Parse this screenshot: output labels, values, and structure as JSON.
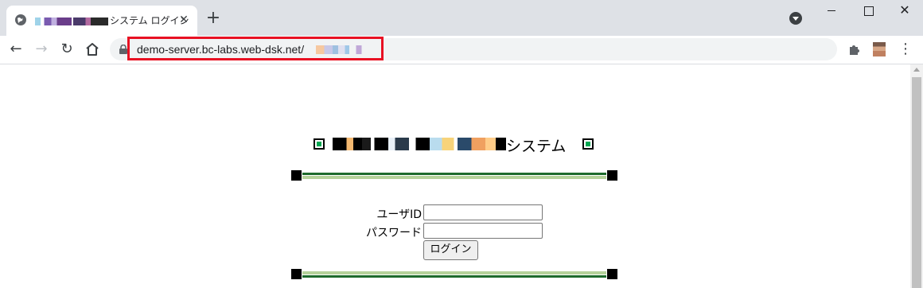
{
  "browser": {
    "tab": {
      "title": "システム ログイン"
    },
    "url": "demo-server.bc-labs.web-dsk.net/",
    "highlight_color": "#e81123"
  },
  "page": {
    "title_suffix": "システム",
    "user_label": "ユーザID",
    "user_value": "",
    "password_label": "パスワード",
    "password_value": "",
    "login_button": "ログイン",
    "accent_dark": "#1e6b2c",
    "accent_light": "#b5d29a"
  }
}
